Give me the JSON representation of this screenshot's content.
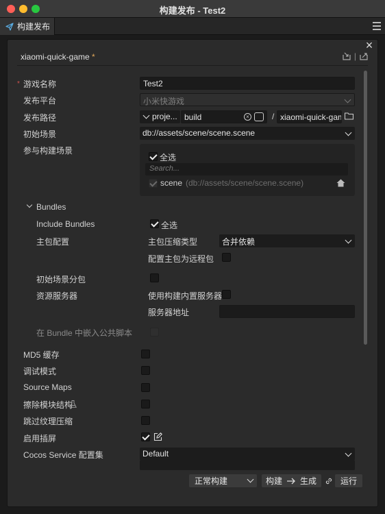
{
  "window": {
    "title": "构建发布 - Test2"
  },
  "tab": {
    "label": "构建发布"
  },
  "header": {
    "title": "xiaomi-quick-game",
    "unsaved_marker": "*",
    "separator": "|"
  },
  "form": {
    "game_name": {
      "label": "游戏名称",
      "value": "Test2",
      "required": "*"
    },
    "platform": {
      "label": "发布平台",
      "value": "小米快游戏"
    },
    "build_path": {
      "label": "发布路径",
      "root": "proje...",
      "dir": "build",
      "slash": "/",
      "output": "xiaomi-quick-gam"
    },
    "start_scene": {
      "label": "初始场景",
      "value": "db://assets/scene/scene.scene"
    },
    "scenes": {
      "label": "参与构建场景",
      "select_all": "全选",
      "search_placeholder": "Search...",
      "items": [
        {
          "name": "scene",
          "path": "(db://assets/scene/scene.scene)"
        }
      ]
    },
    "bundles": {
      "label": "Bundles",
      "include_label": "Include Bundles",
      "include_select_all": "全选",
      "main_pkg_label": "主包配置",
      "compress_label": "主包压缩类型",
      "compress_value": "合并依赖",
      "remote_label": "配置主包为远程包",
      "start_scene_sub_label": "初始场景分包",
      "res_server_label": "资源服务器",
      "builtin_server_label": "使用构建内置服务器",
      "server_addr_label": "服务器地址",
      "embed_label": "在 Bundle 中嵌入公共脚本"
    },
    "md5": {
      "label": "MD5 缓存"
    },
    "debug": {
      "label": "调试模式"
    },
    "source_maps": {
      "label": "Source Maps"
    },
    "erase_module": {
      "label": "擦除模块结构"
    },
    "skip_compress": {
      "label": "跳过纹理压缩"
    },
    "splash": {
      "label": "启用插屏"
    },
    "cocos_service": {
      "label": "Cocos Service 配置集",
      "value": "Default"
    }
  },
  "footer": {
    "build_mode": "正常构建",
    "build": "构建",
    "generate": "生成",
    "run": "运行"
  }
}
